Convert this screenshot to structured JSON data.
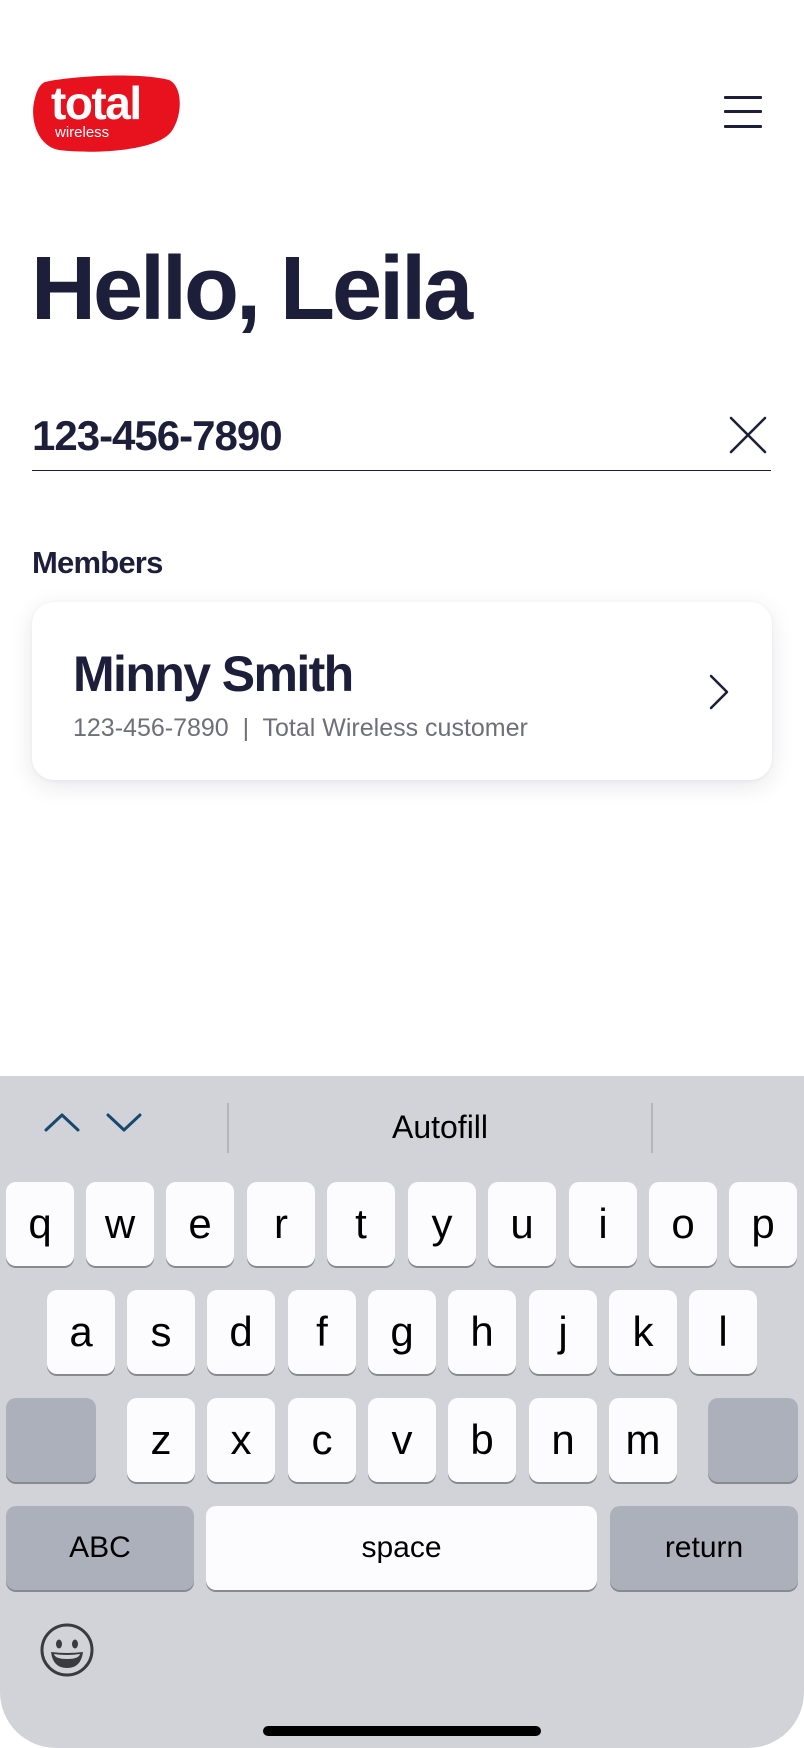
{
  "brand": {
    "name": "total",
    "subname": "wireless",
    "color": "#e8121e"
  },
  "header": {
    "menu_icon": "hamburger-menu-icon"
  },
  "greeting": "Hello, Leila",
  "search": {
    "value": "123-456-7890",
    "clear_icon": "close-icon"
  },
  "members": {
    "label": "Members",
    "items": [
      {
        "name": "Minny Smith",
        "detail": "123-456-7890  |  Total Wireless customer",
        "icon": "chevron-right-icon"
      }
    ]
  },
  "keyboard": {
    "autofill": "Autofill",
    "prev_icon": "chevron-up-icon",
    "next_icon": "chevron-down-icon",
    "row1": [
      "q",
      "w",
      "e",
      "r",
      "t",
      "y",
      "u",
      "i",
      "o",
      "p"
    ],
    "row2": [
      "a",
      "s",
      "d",
      "f",
      "g",
      "h",
      "j",
      "k",
      "l"
    ],
    "row3": [
      "z",
      "x",
      "c",
      "v",
      "b",
      "n",
      "m"
    ],
    "abc": "ABC",
    "space": "space",
    "return": "return",
    "emoji_icon": "emoji-icon"
  },
  "colors": {
    "text_primary": "#1c1e3a",
    "text_secondary": "#6e6f79",
    "keyboard_bg": "#d1d3d9"
  }
}
